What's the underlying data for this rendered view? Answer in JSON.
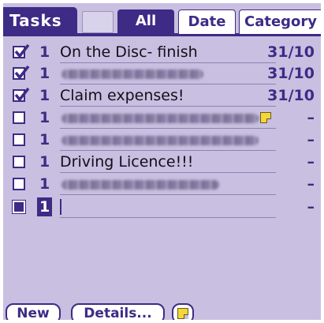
{
  "app": {
    "title": "Tasks",
    "colors": {
      "accent": "#3d2b86",
      "background": "#c9bfe0",
      "note": "#f3d63a"
    }
  },
  "filters": {
    "all": "All",
    "date": "Date",
    "category": "Category",
    "selected": "All"
  },
  "tasks": [
    {
      "checked": true,
      "priority": "1",
      "description": "On the Disc- finish",
      "redacted": false,
      "has_note": false,
      "due": "31/10"
    },
    {
      "checked": true,
      "priority": "1",
      "description": "",
      "redacted": true,
      "has_note": false,
      "due": "31/10"
    },
    {
      "checked": true,
      "priority": "1",
      "description": "Claim expenses!",
      "redacted": false,
      "has_note": false,
      "due": "31/10"
    },
    {
      "checked": false,
      "priority": "1",
      "description": "",
      "redacted": true,
      "has_note": true,
      "due": "–"
    },
    {
      "checked": false,
      "priority": "1",
      "description": "",
      "redacted": true,
      "has_note": false,
      "due": "–"
    },
    {
      "checked": false,
      "priority": "1",
      "description": "Driving Licence!!!",
      "redacted": false,
      "has_note": false,
      "due": "–"
    },
    {
      "checked": false,
      "priority": "1",
      "description": "",
      "redacted": true,
      "has_note": false,
      "due": "–"
    },
    {
      "checked": false,
      "priority": "1",
      "description": "",
      "redacted": false,
      "has_note": false,
      "due": "–",
      "editing": true
    }
  ],
  "buttons": {
    "new": "New",
    "details": "Details...",
    "note_icon": "note-icon"
  }
}
